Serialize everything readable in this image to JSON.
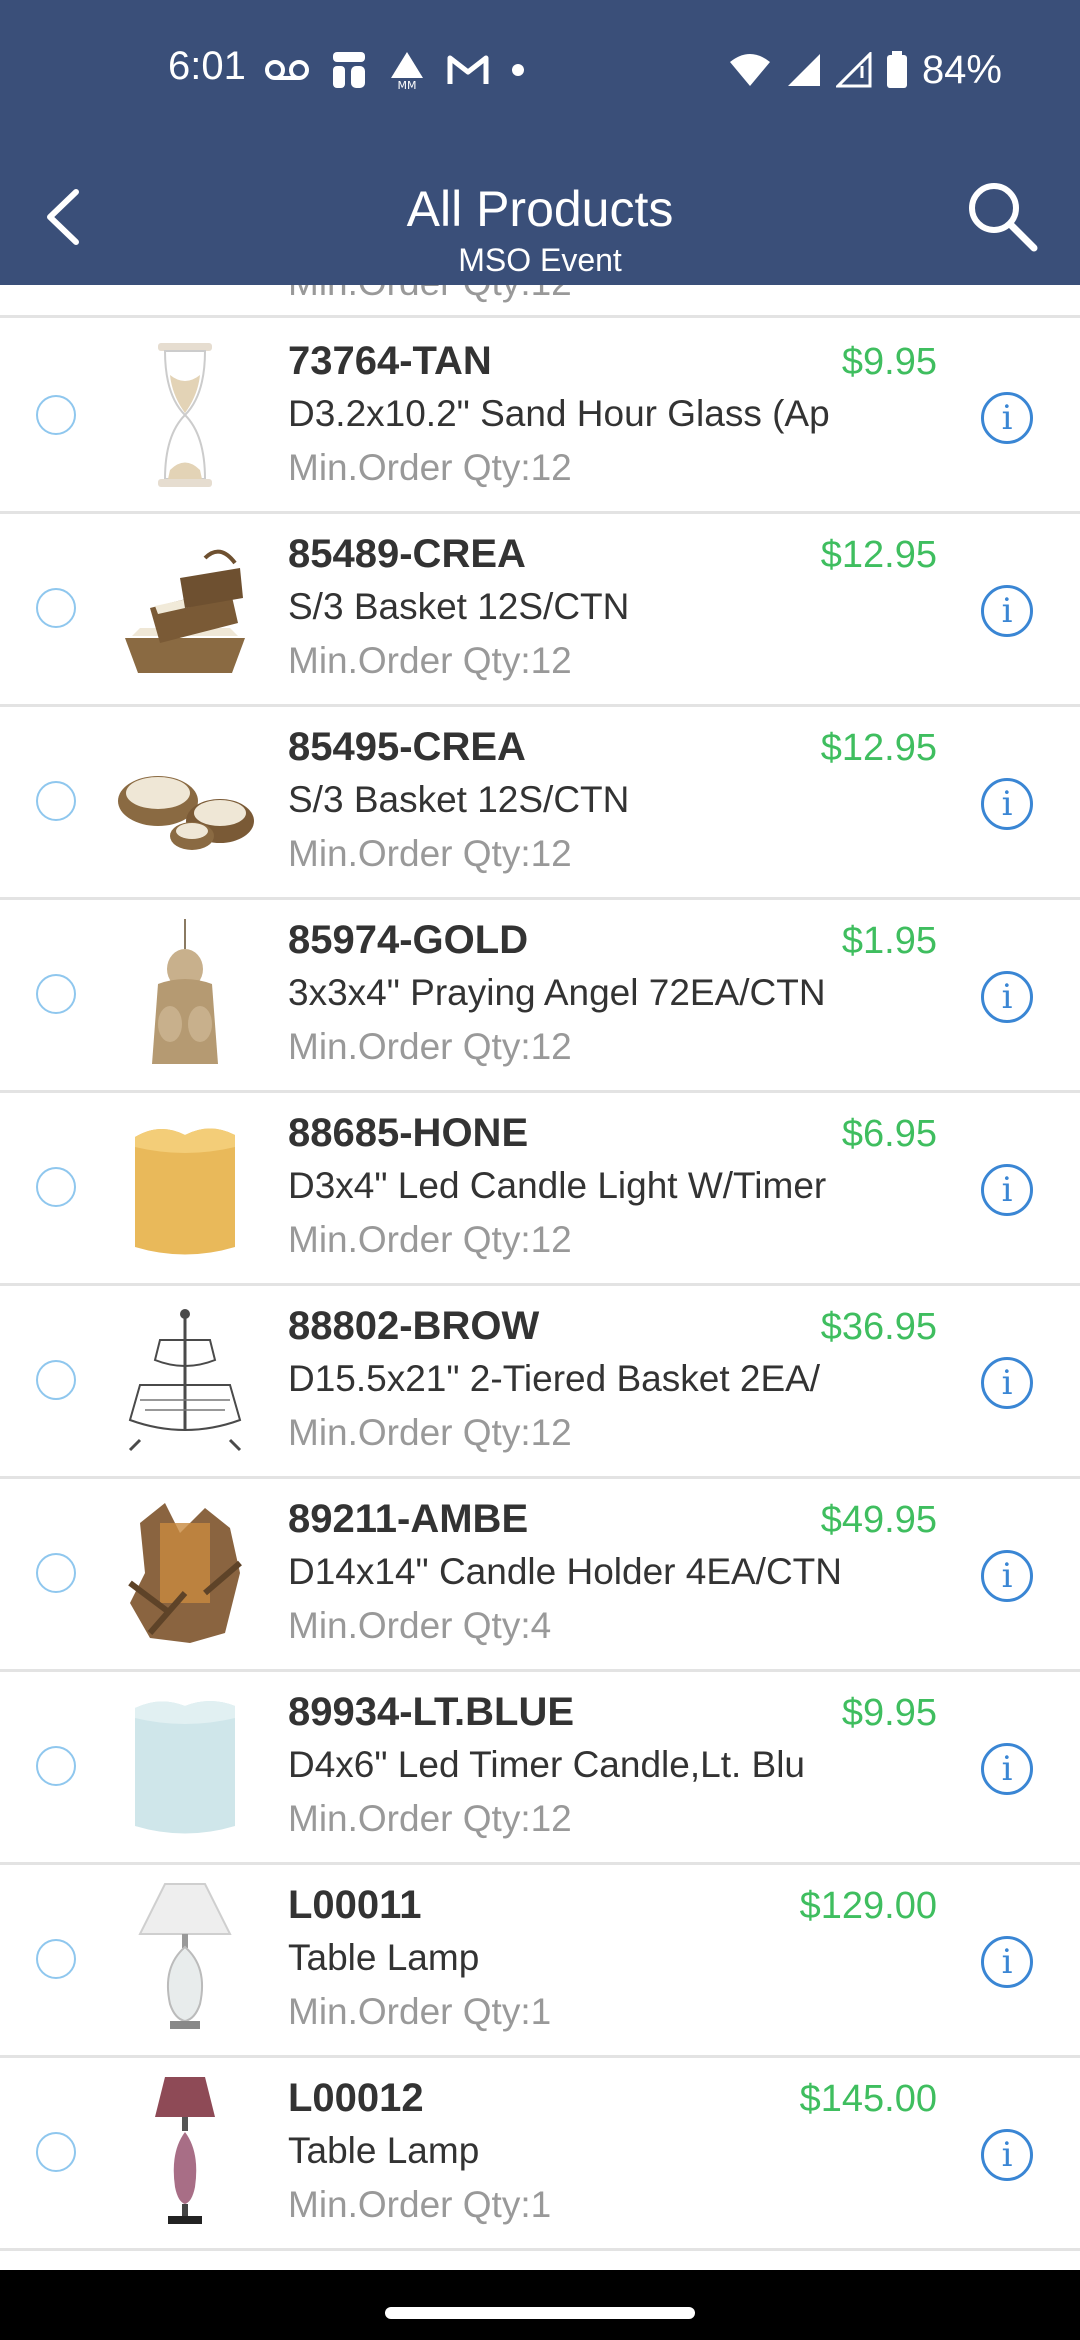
{
  "status_bar": {
    "time": "6:01",
    "battery": "84%"
  },
  "header": {
    "title": "All Products",
    "subtitle": "MSO Event"
  },
  "partial_row": {
    "moq": "Min.Order Qty:12"
  },
  "products": [
    {
      "sku": "73764-TAN",
      "price": "$9.95",
      "desc": "D3.2x10.2\" Sand Hour Glass (Ap",
      "moq": "Min.Order Qty:12",
      "thumb": "hourglass"
    },
    {
      "sku": "85489-CREA",
      "price": "$12.95",
      "desc": "S/3 Basket 12S/CTN",
      "moq": "Min.Order Qty:12",
      "thumb": "basket"
    },
    {
      "sku": "85495-CREA",
      "price": "$12.95",
      "desc": "S/3 Basket 12S/CTN",
      "moq": "Min.Order Qty:12",
      "thumb": "baskets"
    },
    {
      "sku": "85974-GOLD",
      "price": "$1.95",
      "desc": "3x3x4\" Praying  Angel 72EA/CTN",
      "moq": "Min.Order Qty:12",
      "thumb": "angel"
    },
    {
      "sku": "88685-HONE",
      "price": "$6.95",
      "desc": "D3x4\" Led Candle Light W/Timer",
      "moq": "Min.Order Qty:12",
      "thumb": "candle-honey"
    },
    {
      "sku": "88802-BROW",
      "price": "$36.95",
      "desc": "D15.5x21\" 2-Tiered Basket 2EA/",
      "moq": "Min.Order Qty:12",
      "thumb": "tiered-basket"
    },
    {
      "sku": "89211-AMBE",
      "price": "$49.95",
      "desc": "D14x14\"  Candle Holder 4EA/CTN",
      "moq": "Min.Order Qty:4",
      "thumb": "driftwood"
    },
    {
      "sku": "89934-LT.BLUE",
      "price": "$9.95",
      "desc": "D4x6\" Led Timer Candle,Lt. Blu",
      "moq": "Min.Order Qty:12",
      "thumb": "candle-blue"
    },
    {
      "sku": "L00011",
      "price": "$129.00",
      "desc": "Table Lamp",
      "moq": "Min.Order Qty:1",
      "thumb": "lamp-white"
    },
    {
      "sku": "L00012",
      "price": "$145.00",
      "desc": "Table Lamp",
      "moq": "Min.Order Qty:1",
      "thumb": "lamp-plum"
    }
  ],
  "colors": {
    "header": "#3a4f79",
    "price": "#3fbe5f",
    "info": "#3a86d4"
  }
}
